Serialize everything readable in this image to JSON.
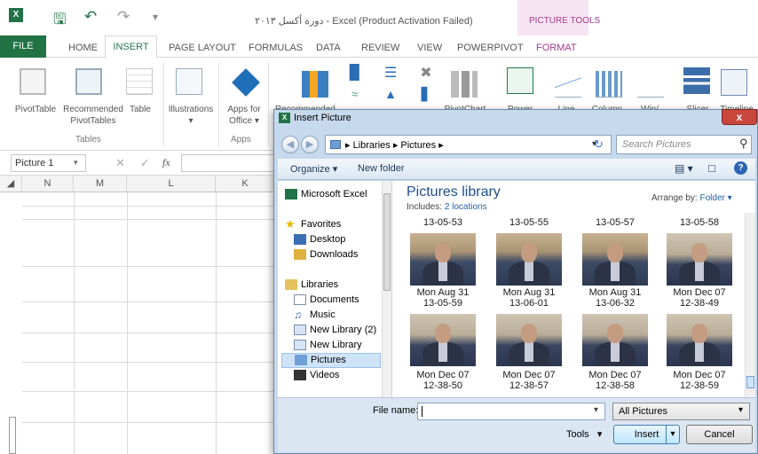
{
  "titlebar": {
    "qat_icons": [
      "excel-logo-icon",
      "save-icon",
      "undo-icon",
      "redo-icon",
      "customize-qat-icon"
    ],
    "doc_title": "دورة أكسل ٢٠١٣ - Excel (Product Activation Failed)",
    "context_group": "PICTURE TOOLS"
  },
  "tabs": [
    "FILE",
    "HOME",
    "INSERT",
    "PAGE LAYOUT",
    "FORMULAS",
    "DATA",
    "REVIEW",
    "VIEW",
    "POWERPIVOT",
    "FORMAT"
  ],
  "ribbon": {
    "pivottable": "PivotTable",
    "recommended_pivot": "Recommended",
    "recommended_pivot_2": "PivotTables",
    "table": "Table",
    "illustrations": "Illustrations",
    "apps_for_office": "Apps for",
    "apps_for_office_2": "Office",
    "recommended_charts": "Recommended",
    "pivotchart": "PivotChart",
    "power": "Power",
    "line": "Line",
    "column": "Column",
    "winloss": "Win/",
    "slicer": "Slicer",
    "timeline": "Timeline",
    "group_tables": "Tables",
    "group_apps": "Apps"
  },
  "formula_bar": {
    "name_box": "Picture 1",
    "fx": "fx"
  },
  "sheet": {
    "columns": [
      "N",
      "M",
      "L",
      "K"
    ]
  },
  "dialog": {
    "title": "Insert Picture",
    "close_label": "x",
    "address": [
      "Libraries",
      "Pictures"
    ],
    "search_placeholder": "Search Pictures",
    "organize": "Organize ▾",
    "new_folder": "New folder",
    "nav": {
      "excel": "Microsoft Excel",
      "favorites": "Favorites",
      "desktop": "Desktop",
      "downloads": "Downloads",
      "libraries": "Libraries",
      "documents": "Documents",
      "music": "Music",
      "new_library_2": "New Library (2)",
      "new_library": "New Library",
      "pictures": "Pictures",
      "videos": "Videos"
    },
    "library_title": "Pictures library",
    "includes_label": "Includes:",
    "includes_link": "2 locations",
    "arrange_label": "Arrange by:",
    "arrange_value": "Folder ▾",
    "top_captions": [
      "13-05-53",
      "13-05-55",
      "13-05-57",
      "13-05-58"
    ],
    "row1": [
      {
        "line1": "Mon Aug 31",
        "line2": "13-05-59"
      },
      {
        "line1": "Mon Aug 31",
        "line2": "13-06-01"
      },
      {
        "line1": "Mon Aug 31",
        "line2": "13-06-32"
      },
      {
        "line1": "Mon Dec 07",
        "line2": "12-38-49"
      }
    ],
    "row2": [
      {
        "line1": "Mon Dec 07",
        "line2": "12-38-50"
      },
      {
        "line1": "Mon Dec 07",
        "line2": "12-38-57"
      },
      {
        "line1": "Mon Dec 07",
        "line2": "12-38-58"
      },
      {
        "line1": "Mon Dec 07",
        "line2": "12-38-59"
      }
    ],
    "filename_label": "File name:",
    "filename_value": "",
    "filetype": "All Pictures",
    "tools": "Tools",
    "insert": "Insert",
    "cancel": "Cancel"
  },
  "colors": {
    "excel_green": "#217346",
    "context_pink": "#a33a8c",
    "dialog_chrome": "#c7d9ec"
  }
}
